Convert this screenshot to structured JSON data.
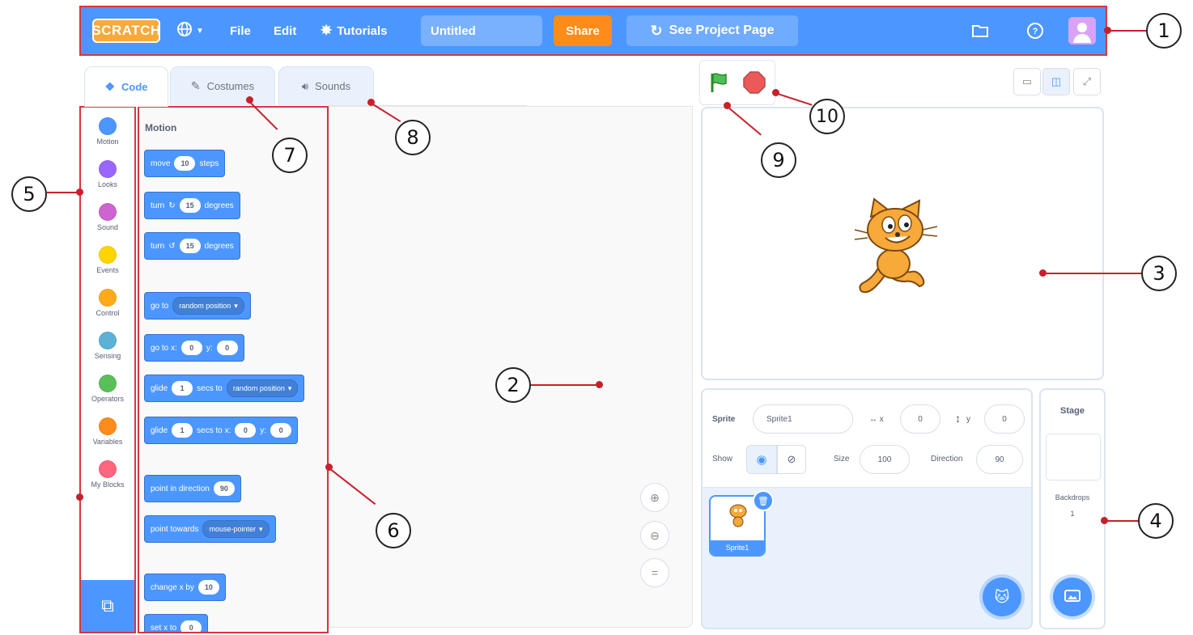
{
  "topbar": {
    "logo": "SCRATCH",
    "menu_file": "File",
    "menu_edit": "Edit",
    "menu_tutorials": "Tutorials",
    "project_title": "Untitled",
    "share": "Share",
    "see_project_page": "See Project Page"
  },
  "tabs": {
    "code": "Code",
    "costumes": "Costumes",
    "sounds": "Sounds"
  },
  "categories": [
    {
      "label": "Motion",
      "color": "#4c97ff"
    },
    {
      "label": "Looks",
      "color": "#9966ff"
    },
    {
      "label": "Sound",
      "color": "#cf63cf"
    },
    {
      "label": "Events",
      "color": "#ffd500"
    },
    {
      "label": "Control",
      "color": "#ffab19"
    },
    {
      "label": "Sensing",
      "color": "#5cb1d6"
    },
    {
      "label": "Operators",
      "color": "#59c059"
    },
    {
      "label": "Variables",
      "color": "#ff8c1a"
    },
    {
      "label": "My Blocks",
      "color": "#ff6680"
    }
  ],
  "palette": {
    "heading": "Motion",
    "move": {
      "a": "move",
      "v": "10",
      "b": "steps"
    },
    "turn_right": {
      "a": "turn",
      "v": "15",
      "b": "degrees"
    },
    "turn_left": {
      "a": "turn",
      "v": "15",
      "b": "degrees"
    },
    "goto": {
      "a": "go to",
      "d": "random position"
    },
    "gotoxy": {
      "a": "go to x:",
      "x": "0",
      "b": "y:",
      "y": "0"
    },
    "glide": {
      "a": "glide",
      "v": "1",
      "b": "secs to",
      "d": "random position"
    },
    "glidexy": {
      "a": "glide",
      "v": "1",
      "b": "secs to x:",
      "x": "0",
      "c": "y:",
      "y": "0"
    },
    "point_dir": {
      "a": "point in direction",
      "v": "90"
    },
    "point_towards": {
      "a": "point towards",
      "d": "mouse-pointer"
    },
    "change_x": {
      "a": "change x by",
      "v": "10"
    },
    "set_x": {
      "a": "set x to",
      "v": "0"
    }
  },
  "sprite_info": {
    "sprite_label": "Sprite",
    "sprite_name": "Sprite1",
    "x_label": "x",
    "x_value": "0",
    "y_label": "y",
    "y_value": "0",
    "show_label": "Show",
    "size_label": "Size",
    "size_value": "100",
    "direction_label": "Direction",
    "direction_value": "90"
  },
  "sprite_list": [
    {
      "name": "Sprite1"
    }
  ],
  "stage_pane": {
    "title": "Stage",
    "backdrops_label": "Backdrops",
    "backdrops_count": "1"
  },
  "callouts": [
    "1",
    "2",
    "3",
    "4",
    "5",
    "6",
    "7",
    "8",
    "9",
    "10"
  ],
  "colors": {
    "topbar": "#4c97ff",
    "share": "#ff8c1a",
    "motion_block": "#4c97ff",
    "annotation": "#c8202b"
  }
}
